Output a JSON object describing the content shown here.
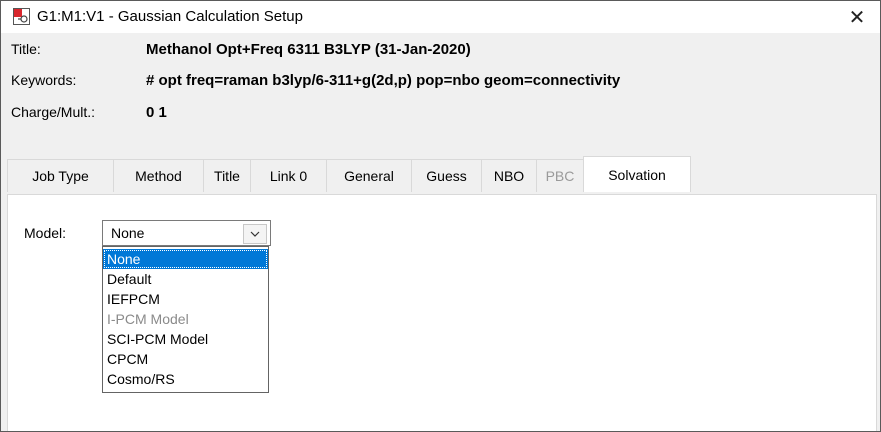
{
  "window": {
    "title": "G1:M1:V1 - Gaussian Calculation Setup",
    "icon": "gaussview-molecule-icon",
    "close_glyph": "✕"
  },
  "header": {
    "title_label": "Title:",
    "title_value": "Methanol Opt+Freq 6311 B3LYP (31-Jan-2020)",
    "keywords_label": "Keywords:",
    "keywords_value": "# opt freq=raman b3lyp/6-311+g(2d,p) pop=nbo geom=connectivity",
    "charge_label": "Charge/Mult.:",
    "charge_value": "0 1"
  },
  "tabs": [
    {
      "label": "Job Type",
      "state": "normal"
    },
    {
      "label": "Method",
      "state": "normal"
    },
    {
      "label": "Title",
      "state": "normal"
    },
    {
      "label": "Link 0",
      "state": "normal"
    },
    {
      "label": "General",
      "state": "normal"
    },
    {
      "label": "Guess",
      "state": "normal"
    },
    {
      "label": "NBO",
      "state": "normal"
    },
    {
      "label": "PBC",
      "state": "disabled"
    },
    {
      "label": "Solvation",
      "state": "active"
    }
  ],
  "solvation": {
    "model_label": "Model:",
    "model_value": "None",
    "options": [
      {
        "label": "None",
        "state": "selected"
      },
      {
        "label": "Default",
        "state": "normal"
      },
      {
        "label": "IEFPCM",
        "state": "normal"
      },
      {
        "label": "I-PCM Model",
        "state": "disabled"
      },
      {
        "label": "SCI-PCM Model",
        "state": "normal"
      },
      {
        "label": "CPCM",
        "state": "normal"
      },
      {
        "label": "Cosmo/RS",
        "state": "normal"
      }
    ]
  },
  "colors": {
    "selection": "#0078d7",
    "window_bg": "#f0f0f0",
    "panel_bg": "#ffffff",
    "disabled_text": "#9a9a9a"
  }
}
